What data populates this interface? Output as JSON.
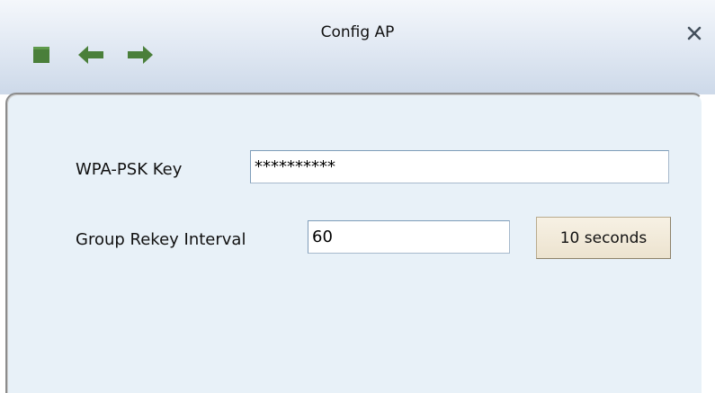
{
  "window": {
    "title": "Config AP"
  },
  "toolbar": {
    "icons": [
      "stop-icon",
      "back-arrow-icon",
      "forward-arrow-icon"
    ],
    "icon_color": "#4a7f3a"
  },
  "form": {
    "wpa_psk_key": {
      "label": "WPA-PSK Key",
      "value": "**********"
    },
    "group_rekey_interval": {
      "label": "Group Rekey Interval",
      "value": "60",
      "unit_button": "10 seconds"
    }
  },
  "colors": {
    "panel_background": "#e8f1f8",
    "titlebar_background": "#dfe7f2",
    "button_background": "#ece3cf"
  }
}
